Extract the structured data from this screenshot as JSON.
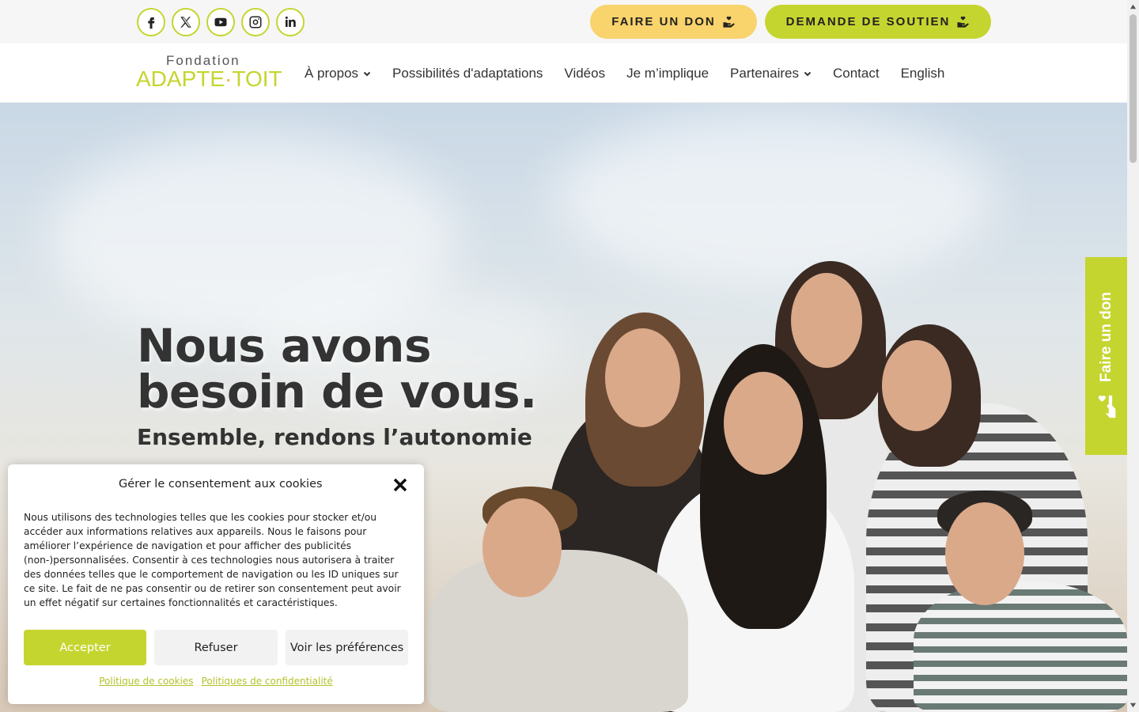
{
  "topbar": {
    "socials": [
      {
        "icon": "facebook-icon"
      },
      {
        "icon": "x-twitter-icon"
      },
      {
        "icon": "youtube-icon"
      },
      {
        "icon": "instagram-icon"
      },
      {
        "icon": "linkedin-icon"
      }
    ],
    "donate_label": "FAIRE UN DON",
    "support_label": "DEMANDE DE SOUTIEN"
  },
  "logo": {
    "top": "Fondation",
    "bottom_left": "ADAPTE",
    "separator": "·",
    "bottom_right": "TOIT"
  },
  "nav": {
    "items": [
      {
        "label": "À propos",
        "has_dropdown": true
      },
      {
        "label": "Possibilités d'adaptations",
        "has_dropdown": false
      },
      {
        "label": "Vidéos",
        "has_dropdown": false
      },
      {
        "label": "Je m’implique",
        "has_dropdown": false
      },
      {
        "label": "Partenaires",
        "has_dropdown": true
      },
      {
        "label": "Contact",
        "has_dropdown": false
      },
      {
        "label": "English",
        "has_dropdown": false
      }
    ]
  },
  "hero": {
    "title": "Nous avons besoin de vous.",
    "subtitle": "Ensemble, rendons l’autonomie"
  },
  "side_tab": {
    "label": "Faire un don"
  },
  "cookie": {
    "title": "Gérer le consentement aux cookies",
    "text": "Nous utilisons des technologies telles que les cookies pour stocker et/ou accéder aux informations relatives aux appareils. Nous le faisons pour améliorer l’expérience de navigation et pour afficher des publicités (non-)personnalisées. Consentir à ces technologies nous autorisera à traiter des données telles que le comportement de navigation ou les ID uniques sur ce site. Le fait de ne pas consentir ou de retirer son consentement peut avoir un effet négatif sur certaines fonctionnalités et caractéristiques.",
    "accept_label": "Accepter",
    "refuse_label": "Refuser",
    "prefs_label": "Voir les préférences",
    "link_cookies": "Politique de cookies",
    "link_privacy": "Politiques de confidentialité"
  },
  "colors": {
    "accent_green": "#c5d52f",
    "accent_yellow": "#f9d36b",
    "text_dark": "#333333"
  }
}
